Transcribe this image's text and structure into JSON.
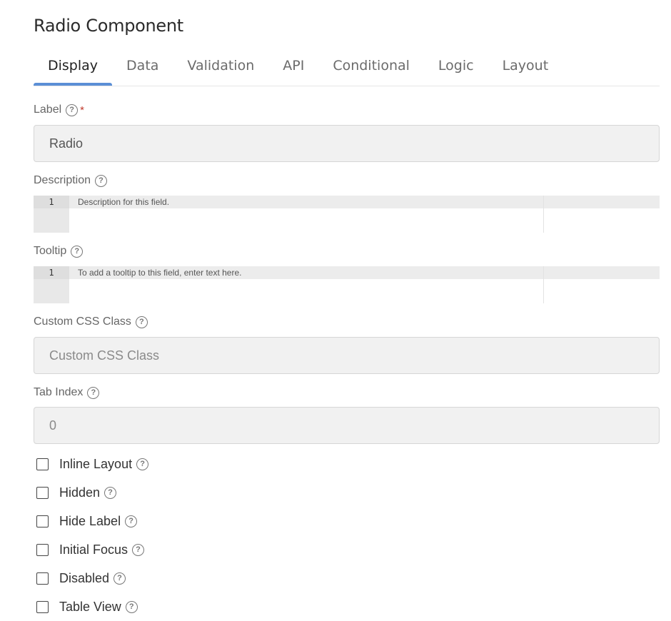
{
  "title": "Radio Component",
  "tabs": [
    {
      "label": "Display"
    },
    {
      "label": "Data"
    },
    {
      "label": "Validation"
    },
    {
      "label": "API"
    },
    {
      "label": "Conditional"
    },
    {
      "label": "Logic"
    },
    {
      "label": "Layout"
    }
  ],
  "active_tab": "Display",
  "help_glyph": "?",
  "required_mark": "*",
  "fields": {
    "label": {
      "label": "Label",
      "value": "Radio"
    },
    "description": {
      "label": "Description",
      "line_number": "1",
      "placeholder": "Description for this field."
    },
    "tooltip": {
      "label": "Tooltip",
      "line_number": "1",
      "placeholder": "To add a tooltip to this field, enter text here."
    },
    "custom_css": {
      "label": "Custom CSS Class",
      "placeholder": "Custom CSS Class"
    },
    "tab_index": {
      "label": "Tab Index",
      "placeholder": "0"
    }
  },
  "checkboxes": [
    {
      "label": "Inline Layout",
      "checked": false
    },
    {
      "label": "Hidden",
      "checked": false
    },
    {
      "label": "Hide Label",
      "checked": false
    },
    {
      "label": "Initial Focus",
      "checked": false
    },
    {
      "label": "Disabled",
      "checked": false
    },
    {
      "label": "Table View",
      "checked": false
    }
  ],
  "colors": {
    "accent": "#5b8fd6",
    "required": "#c0392b",
    "input_bg": "#f1f1f1"
  }
}
